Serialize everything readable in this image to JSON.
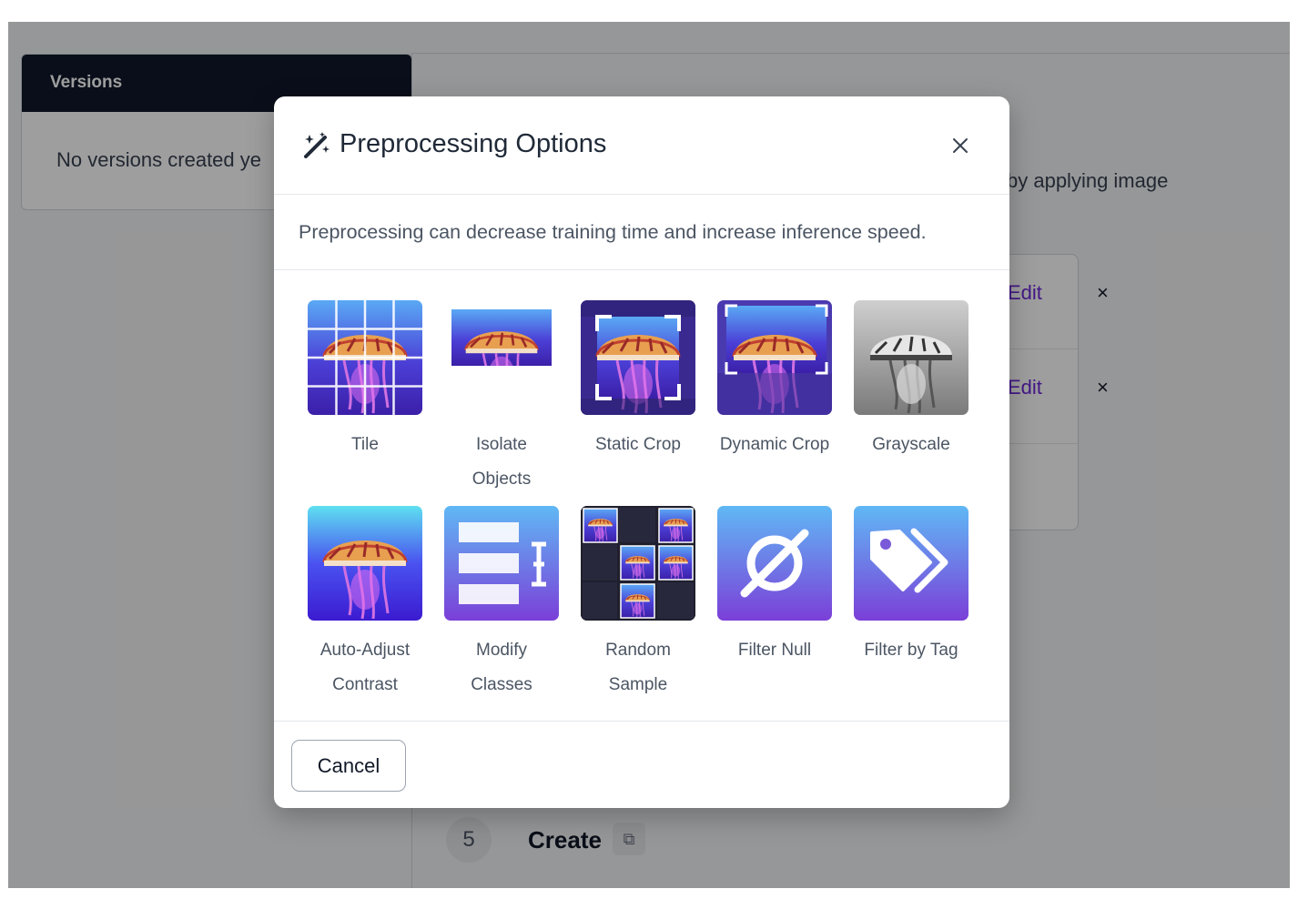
{
  "background": {
    "versions_header": "Versions",
    "versions_empty": "No versions created ye",
    "description_fragment": "by applying image",
    "step_rows": [
      {
        "edit_label": "Edit",
        "remove_label": "×"
      },
      {
        "edit_label": "Edit",
        "remove_label": "×"
      }
    ],
    "step_number": "5",
    "create_label": "Create"
  },
  "modal": {
    "title": "Preprocessing Options",
    "description": "Preprocessing can decrease training time and increase inference speed.",
    "options": [
      {
        "label_lines": [
          "Tile"
        ],
        "icon": "tile-grid-image"
      },
      {
        "label_lines": [
          "Isolate",
          "Objects"
        ],
        "icon": "isolate-objects-image"
      },
      {
        "label_lines": [
          "Static Crop"
        ],
        "icon": "static-crop-image"
      },
      {
        "label_lines": [
          "Dynamic Crop"
        ],
        "icon": "dynamic-crop-image"
      },
      {
        "label_lines": [
          "Grayscale"
        ],
        "icon": "grayscale-image"
      },
      {
        "label_lines": [
          "Auto-Adjust",
          "Contrast"
        ],
        "icon": "contrast-image"
      },
      {
        "label_lines": [
          "Modify",
          "Classes"
        ],
        "icon": "modify-classes-icon"
      },
      {
        "label_lines": [
          "Random",
          "Sample"
        ],
        "icon": "random-sample-image"
      },
      {
        "label_lines": [
          "Filter Null"
        ],
        "icon": "filter-null-icon"
      },
      {
        "label_lines": [
          "Filter by Tag"
        ],
        "icon": "filter-tag-icon"
      }
    ],
    "cancel_label": "Cancel"
  },
  "colors": {
    "accent_purple": "#6d28d9",
    "dark_header": "#0f172a",
    "overlay": "rgba(0,0,0,0.38)"
  }
}
